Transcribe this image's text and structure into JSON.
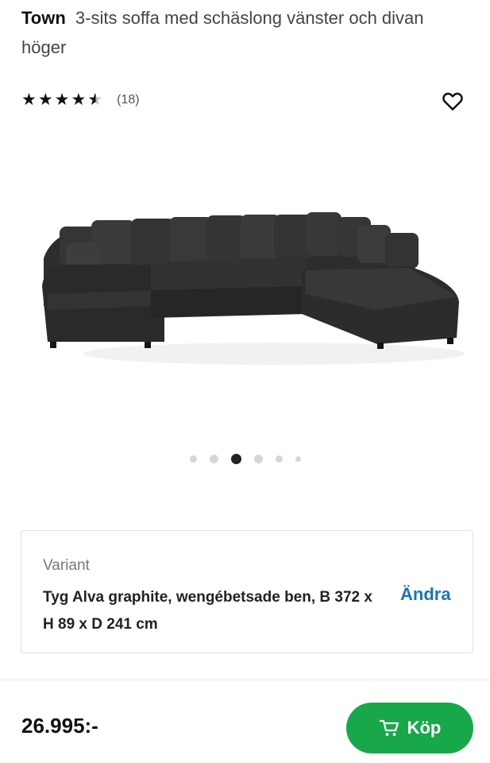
{
  "product": {
    "brand": "Town",
    "name": "3-sits soffa med schäslong vänster och divan höger",
    "rating_value": 4.5,
    "rating_count": "(18)"
  },
  "icons": {
    "favorite": "heart-icon",
    "cart": "cart-icon"
  },
  "gallery": {
    "image_count": 6,
    "active_index": 2
  },
  "variant": {
    "label": "Variant",
    "value": "Tyg Alva graphite, wengébetsade ben, B 372 x H 89 x D 241 cm",
    "change_label": "Ändra"
  },
  "footer": {
    "price": "26.995:-",
    "buy_label": "Köp"
  },
  "colors": {
    "accent_green": "#18a84a",
    "link_blue": "#1d74b8"
  }
}
